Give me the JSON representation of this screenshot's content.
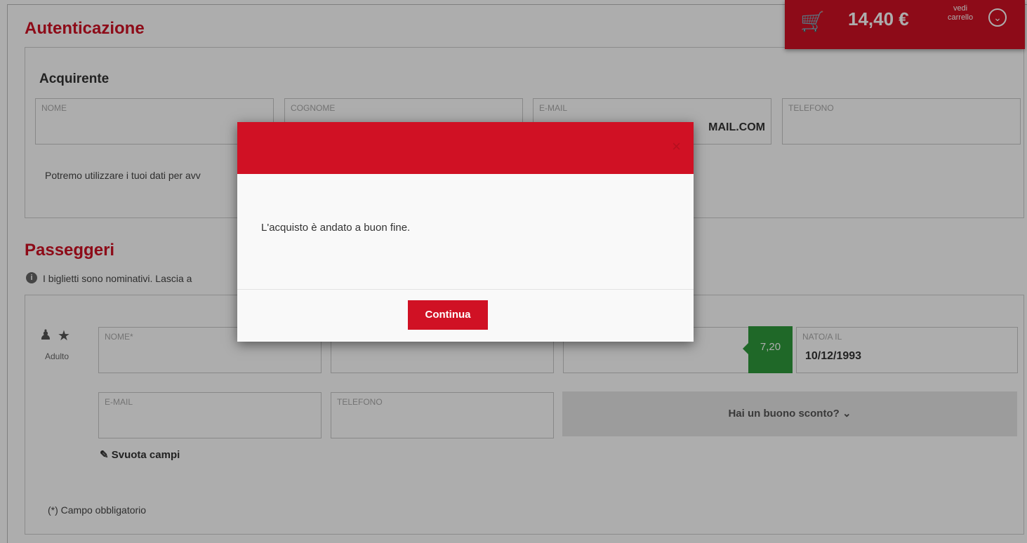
{
  "cart": {
    "total": "14,40 €",
    "vedi_line1": "vedi",
    "vedi_line2": "carrello"
  },
  "auth": {
    "title": "Autenticazione",
    "buyer_heading": "Acquirente",
    "fields": {
      "nome": "NOME",
      "cognome": "COGNOME",
      "email": "E-MAIL",
      "email_value": "MAIL.COM",
      "telefono": "TELEFONO"
    },
    "privacy_text": "Potremo utilizzare i tuoi dati per avv"
  },
  "passengers": {
    "title": "Passeggeri",
    "info_text": "I biglietti sono nominativi. Lascia a",
    "type_label": "Adulto",
    "fields": {
      "nome": "NOME*",
      "nato_il": "NATO/A IL",
      "nato_il_value": "10/12/1993",
      "email": "E-MAIL",
      "telefono": "TELEFONO"
    },
    "price": "7,20",
    "discount_label": "Hai un buono sconto? ⌄",
    "clear_label": "Svuota campi",
    "required_note": "(*) Campo obbligatorio"
  },
  "modal": {
    "message": "L'acquisto è andato a buon fine.",
    "button_label": "Continua",
    "close_symbol": "×"
  },
  "colors": {
    "brand_red": "#d01124",
    "price_green": "#2f9a3b"
  }
}
